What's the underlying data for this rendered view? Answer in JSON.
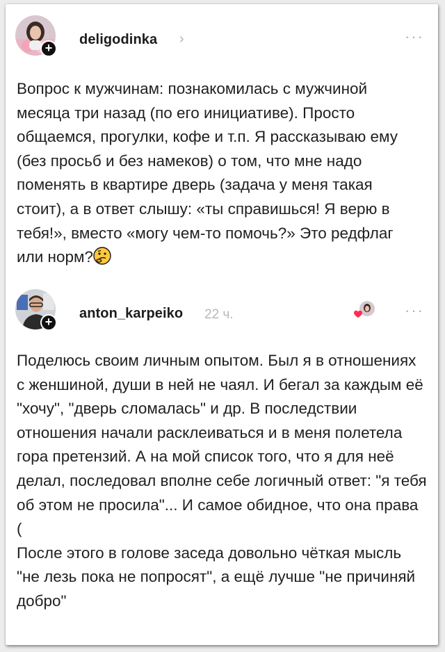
{
  "post": {
    "username": "deligodinka",
    "chevron": "›",
    "more_label": "···",
    "text": "Вопрос к мужчинам: познакомилась с мужчиной месяца три назад (по его инициативе). Просто общаемся, прогулки, кофе и т.п. Я рассказываю ему (без просьб и без намеков) о том, что мне надо поменять в квартире дверь (задача у меня такая стоит), а в ответ слышу: «ты справишься! Я верю в тебя!», вместо «могу чем-то помочь?» Это редфлаг или норм?",
    "emoji": "thinking-face-emoji"
  },
  "reply": {
    "username": "anton_karpeiko",
    "timestamp": "22 ч.",
    "more_label": "···",
    "liked_by_author": true,
    "text": "Поделюсь своим личным опытом. Был я в отношениях с женшиной, души в ней не чаял. И бегал за каждым её \"хочу\", \"дверь сломалась\" и др. В последствии отношения начали расклеиваться и в меня полетела гора претензий. А на мой список того, что я для неё делал, последовал вполне себе логичный ответ: \"я тебя об этом не просила\"... И самое обидное, что она права (\nПосле этого в голове заседа довольно чёткая мысль \"не лезь пока не попросят\", а ещё лучше \"не причиняй добро\""
  },
  "icons": {
    "follow": "plus-icon",
    "more": "more-horizontal-icon",
    "like": "heart-icon"
  },
  "colors": {
    "background": "#ececec",
    "card": "#ffffff",
    "text": "#1f1f1f",
    "muted": "#b3b3b3",
    "like": "#ff2d55"
  }
}
